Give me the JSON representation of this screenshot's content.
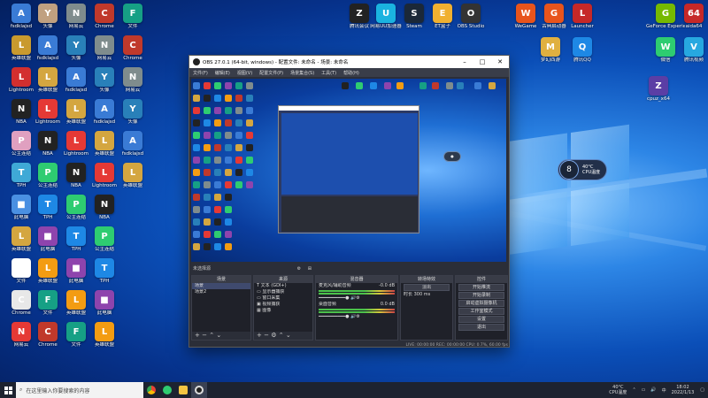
{
  "desktop": {
    "icons": [
      {
        "label": "fsdklajsd",
        "color": "#3a7bd5",
        "g": "A"
      },
      {
        "label": "英雄联盟",
        "color": "#c99a2e",
        "g": "L"
      },
      {
        "label": "Lightroom",
        "color": "#d32f2f",
        "g": "L"
      },
      {
        "label": "NBA",
        "color": "#222222",
        "g": "N"
      },
      {
        "label": "公主连结",
        "color": "#e0a0c0",
        "g": "P"
      },
      {
        "label": "TPH",
        "color": "#3fa9d6",
        "g": "T"
      },
      {
        "label": "此电脑",
        "color": "#4a90e2",
        "g": "■"
      },
      {
        "label": "英雄联盟",
        "color": "#d4a640",
        "g": "L"
      },
      {
        "label": "文件",
        "color": "#ffffff",
        "g": "F"
      },
      {
        "label": "Chrome",
        "color": "#e8e8e8",
        "g": "C"
      },
      {
        "label": "网易云",
        "color": "#e53935",
        "g": "N"
      },
      {
        "label": "头像",
        "color": "#c0a080",
        "g": "Y"
      }
    ],
    "top_icons": [
      {
        "label": "腾讯会议",
        "color": "#222",
        "g": "Z"
      },
      {
        "label": "网易UU加速器",
        "color": "#1ab3e0",
        "g": "U"
      },
      {
        "label": "Steam",
        "color": "#1b2838",
        "g": "S"
      },
      {
        "label": "ET盒子",
        "color": "#f0b030",
        "g": "E"
      },
      {
        "label": "OBS Studio",
        "color": "#333",
        "g": "O"
      },
      {
        "label": "WeGame",
        "color": "#e8541c",
        "g": "W"
      },
      {
        "label": "古典启动器",
        "color": "#e8541c",
        "g": "G"
      },
      {
        "label": "Launcher",
        "color": "#c62828",
        "g": "L"
      },
      {
        "label": "GeForce Experience",
        "color": "#76b900",
        "g": "G"
      },
      {
        "label": "aida64",
        "color": "#c62828",
        "g": "64"
      }
    ],
    "right_icons": [
      {
        "label": "梦幻西游",
        "color": "#e0b040",
        "g": "M"
      },
      {
        "label": "腾讯QQ",
        "color": "#1e88e5",
        "g": "Q"
      },
      {
        "label": "微信",
        "color": "#2ecc71",
        "g": "W"
      },
      {
        "label": "腾讯视频",
        "color": "#27a8e0",
        "g": "V"
      },
      {
        "label": "cpuz_x64",
        "color": "#5b3ea5",
        "g": "Z"
      }
    ]
  },
  "obs": {
    "title": "OBS 27.0.1 (64-bit, windows) - 配置文件: 未命名 - 场景: 未命名",
    "menu": [
      "文件(F)",
      "编辑(E)",
      "视图(V)",
      "配置文件(P)",
      "场景集合(S)",
      "工具(T)",
      "帮助(H)"
    ],
    "dock_label": "未选择源",
    "scene_header": "场景",
    "scenes": [
      "场景",
      "场景2"
    ],
    "source_header": "来源",
    "sources": [
      "文本 (GDI+)",
      "显示器捕获",
      "窗口采集",
      "视频捕获",
      "图像"
    ],
    "mixer_header": "混音器",
    "mixer": [
      {
        "name": "麦克风/辅助音频",
        "db": "-0.0 dB"
      },
      {
        "name": "桌面音频",
        "db": "0.0 dB"
      }
    ],
    "transition_header": "转场特效",
    "transition_value": "淡出",
    "duration_label": "时长",
    "duration_value": "300 ms",
    "controls_header": "控件",
    "controls": [
      "开始推流",
      "开始录制",
      "启动虚拟摄像机",
      "工作室模式",
      "设置",
      "退出"
    ],
    "status": "LIVE: 00:00:00   REC: 00:00:00   CPU: 0.7%, 60.00 fps"
  },
  "cpu_badge": {
    "value": "8",
    "temp": "40°C",
    "label": "CPU温度"
  },
  "taskbar": {
    "search_placeholder": "在这里输入你要搜索的内容",
    "cpu_temp": "40°C",
    "cpu_label": "CPU温度",
    "time": "18:02",
    "date": "2022/1/13"
  }
}
